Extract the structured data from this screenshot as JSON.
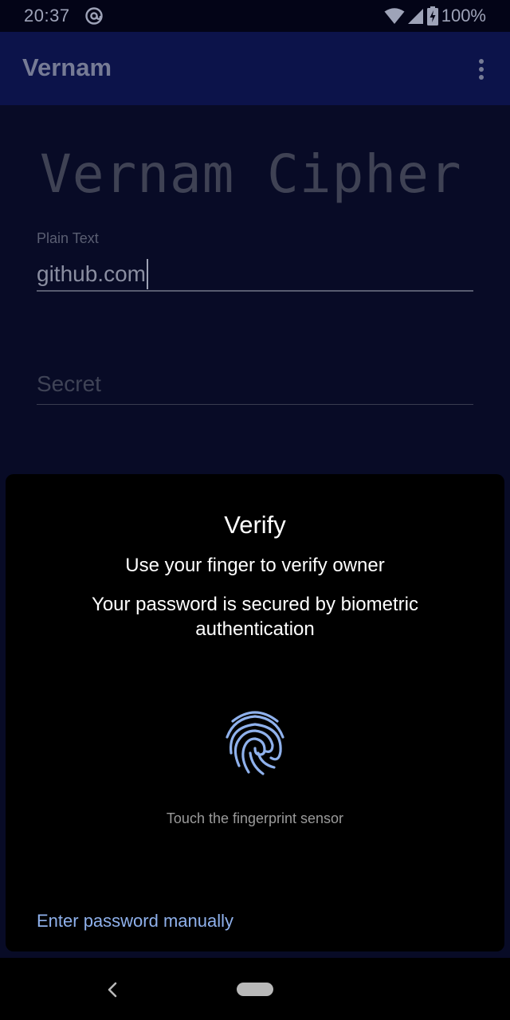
{
  "status_bar": {
    "time": "20:37",
    "battery": "100%",
    "icons": [
      "at-sign-icon",
      "wifi-icon",
      "cellular-signal-icon",
      "battery-charging-icon"
    ]
  },
  "app_bar": {
    "title": "Vernam",
    "menu_icon": "overflow-menu-icon"
  },
  "content": {
    "heading": "Vernam Cipher",
    "plain_text_label": "Plain Text",
    "plain_text_value": "github.com",
    "secret_placeholder": "Secret"
  },
  "dialog": {
    "title": "Verify",
    "subtitle": "Use your finger to verify owner",
    "description": "Your password is secured by biometric authentication",
    "hint": "Touch the fingerprint sensor",
    "negative_button": "Enter password manually",
    "icon": "fingerprint-icon",
    "accent_color": "#8fb1ec"
  },
  "nav_bar": {
    "icons": [
      "back-icon",
      "home-pill"
    ]
  }
}
